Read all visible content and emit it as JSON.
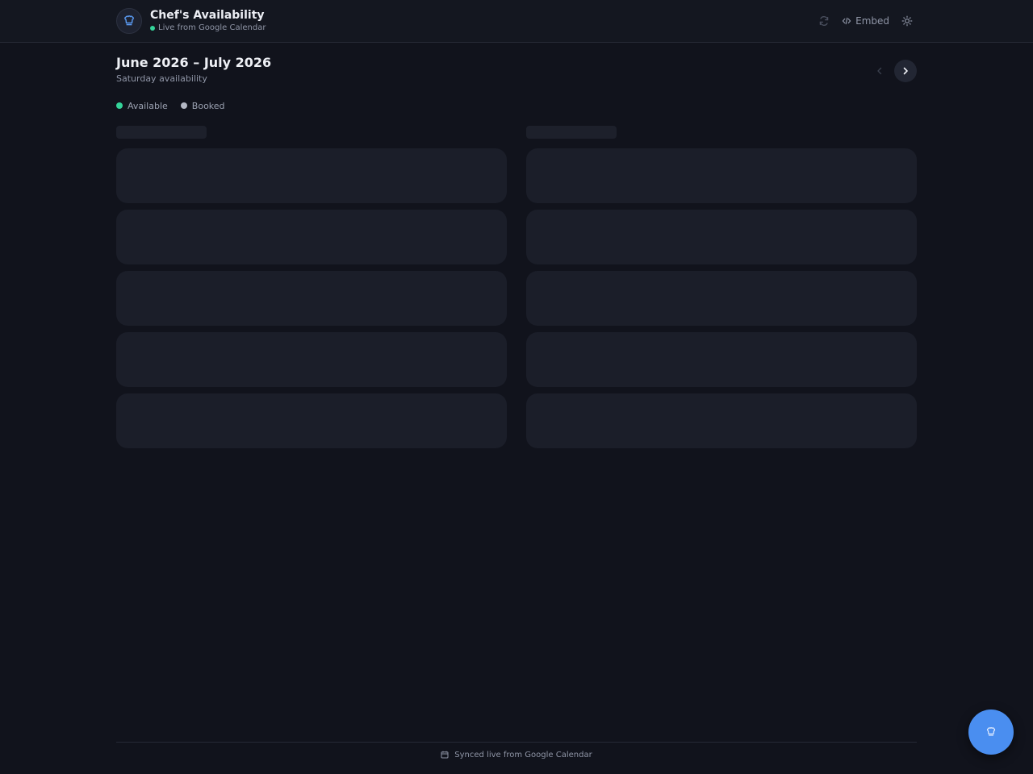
{
  "header": {
    "title": "Chef's Availability",
    "subtitle": "Live from Google Calendar",
    "embed_label": "Embed",
    "icons": {
      "logo": "chef-hat-icon",
      "refresh": "refresh-icon",
      "embed": "code-icon",
      "theme": "sun-icon"
    }
  },
  "calendar": {
    "range_title": "June 2026 – July 2026",
    "subtitle": "Saturday availability",
    "nav_prev_icon": "chevron-left-icon",
    "nav_next_icon": "chevron-right-icon",
    "state": "loading",
    "columns": [
      {
        "slot_placeholders": 5
      },
      {
        "slot_placeholders": 5
      }
    ]
  },
  "legend": [
    {
      "label": "Available",
      "color": "#34d399"
    },
    {
      "label": "Booked",
      "color": "#b4b8c4"
    }
  ],
  "footer": {
    "text": "Synced live from Google Calendar",
    "icon": "calendar-icon"
  },
  "fab": {
    "icon": "chef-hat-icon"
  },
  "colors": {
    "background": "#11131c",
    "accent": "#4a8ef0",
    "live": "#34d399"
  }
}
